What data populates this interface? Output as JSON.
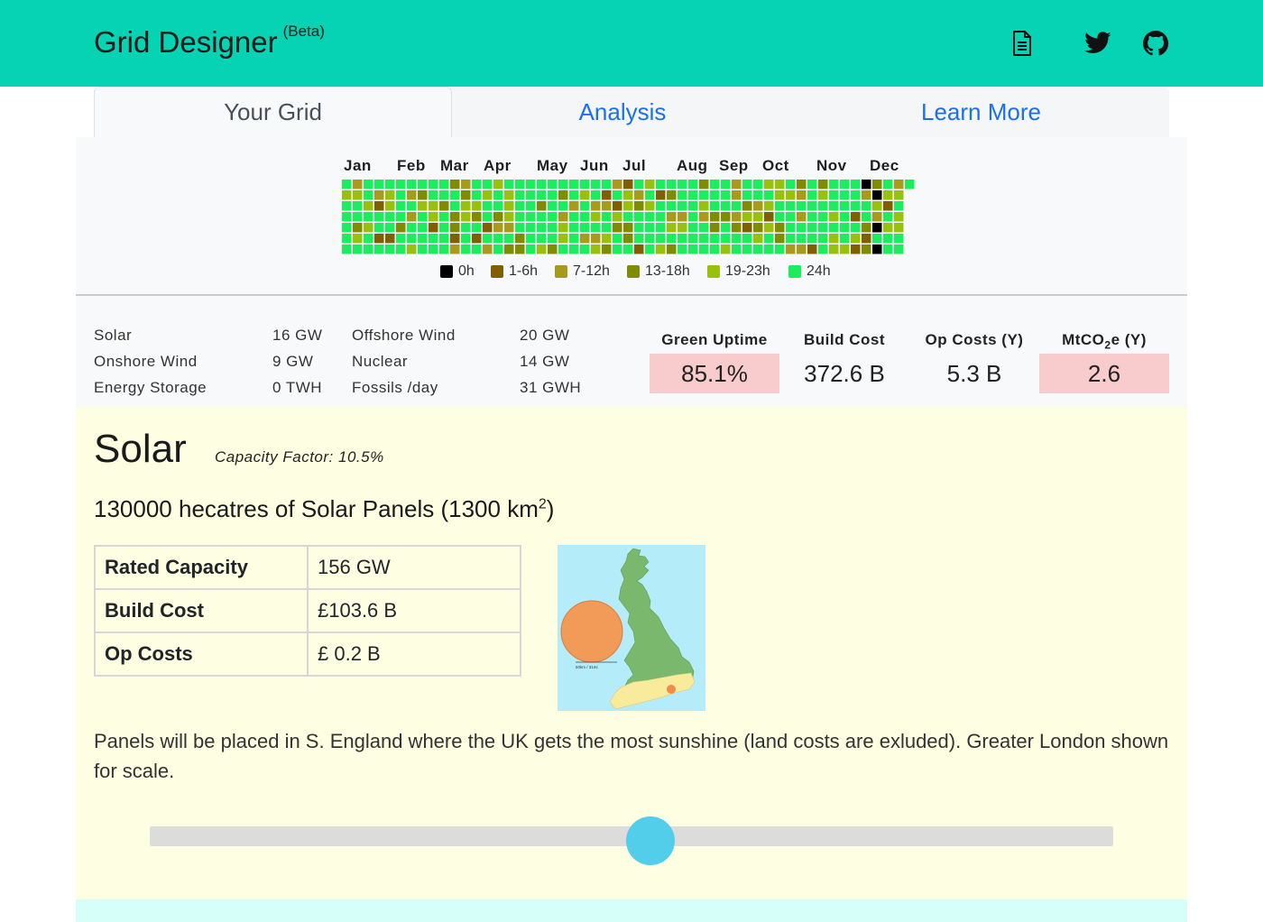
{
  "app": {
    "title": "Grid Designer",
    "badge": "(Beta)"
  },
  "nav_icons": [
    "document-icon",
    "twitter-icon",
    "github-icon"
  ],
  "tabs": [
    {
      "label": "Your Grid",
      "active": true
    },
    {
      "label": "Analysis",
      "active": false
    },
    {
      "label": "Learn More",
      "active": false
    }
  ],
  "calendar": {
    "months": [
      "Jan",
      "Feb",
      "Mar",
      "Apr",
      "May",
      "Jun",
      "Jul",
      "Aug",
      "Sep",
      "Oct",
      "Nov",
      "Dec"
    ],
    "legend": [
      {
        "label": "0h",
        "color": "#000000"
      },
      {
        "label": "1-6h",
        "color": "#7f5f00"
      },
      {
        "label": "7-12h",
        "color": "#a89b1c"
      },
      {
        "label": "13-18h",
        "color": "#7f8c00"
      },
      {
        "label": "19-23h",
        "color": "#98c10e"
      },
      {
        "label": "24h",
        "color": "#1aee5c"
      }
    ]
  },
  "capacities": {
    "solar": {
      "label": "Solar",
      "value": "16 GW"
    },
    "onshore": {
      "label": "Onshore Wind",
      "value": "9 GW"
    },
    "storage": {
      "label": "Energy Storage",
      "value": "0 TWH"
    },
    "offshore": {
      "label": "Offshore Wind",
      "value": "20 GW"
    },
    "nuclear": {
      "label": "Nuclear",
      "value": "14 GW"
    },
    "fossils": {
      "label": "Fossils /day",
      "value": "31 GWH"
    }
  },
  "stats": {
    "uptime": {
      "label": "Green Uptime",
      "value": "85.1%"
    },
    "build": {
      "label": "Build Cost",
      "value": "372.6 B"
    },
    "opcost": {
      "label": "Op Costs (Y)",
      "value": "5.3 B"
    },
    "co2": {
      "label_pre": "MtCO",
      "label_sub": "2",
      "label_post": "e (Y)",
      "value": "2.6"
    }
  },
  "solar": {
    "title": "Solar",
    "capacity_factor": "Capacity Factor: 10.5%",
    "area_pre": "130000 hecatres of Solar Panels (1300 km",
    "area_sup": "2",
    "area_post": ")",
    "table": [
      {
        "key": "Rated Capacity",
        "value": "156 GW"
      },
      {
        "key": "Build Cost",
        "value": "£103.6 B"
      },
      {
        "key": "Op Costs",
        "value": "£ 0.2 B"
      }
    ],
    "map_scale_text": "50km / 31mi",
    "description": "Panels will be placed in S. England where the UK gets the most sunshine (land costs are exluded). Greater London shown for scale.",
    "slider_fraction": 0.52
  },
  "colors": {
    "navbar": "#06d2b4",
    "link": "#1a6ff5",
    "bad_stat": "#f8cccc",
    "solar_bg": "#fefee2",
    "slider_thumb": "#52cdea"
  }
}
